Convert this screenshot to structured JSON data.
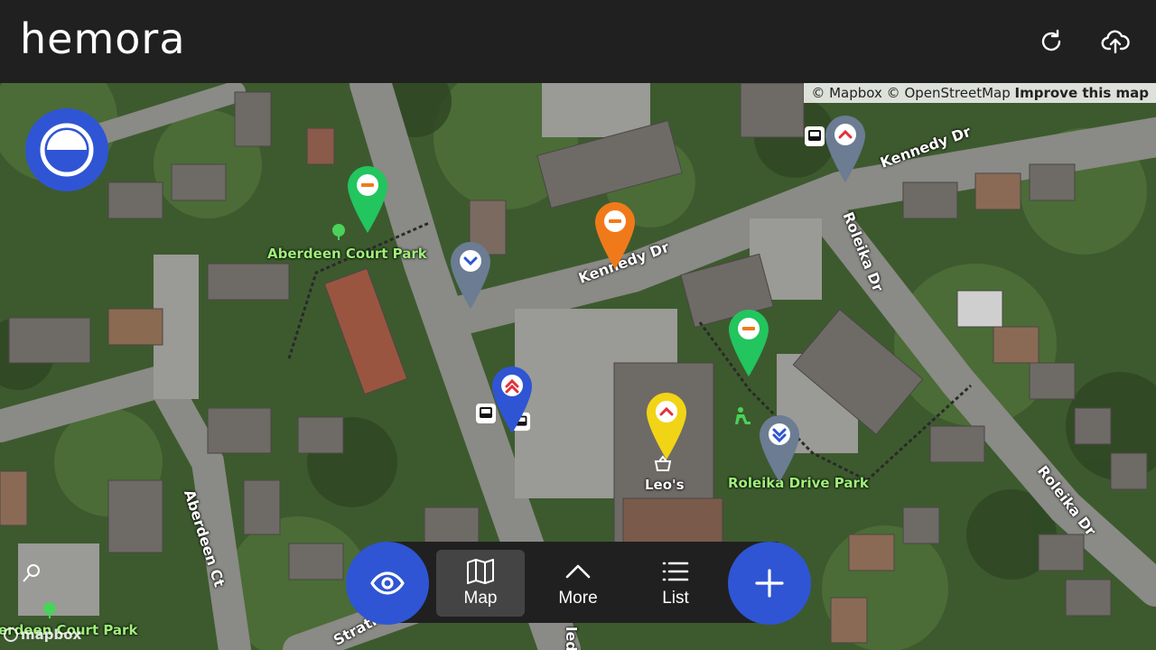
{
  "header": {
    "brand": "hemora",
    "refresh_icon": "refresh-icon",
    "upload_icon": "cloud-upload-icon"
  },
  "map": {
    "attribution": {
      "mapbox": "© Mapbox",
      "osm": "© OpenStreetMap",
      "improve": "Improve this map"
    },
    "logo": "mapbox",
    "labels": {
      "aberdeen_park_top": "Aberdeen Court Park",
      "aberdeen_park_bottom": "erdeen Court Park",
      "kennedy_dr_1": "Kennedy Dr",
      "kennedy_dr_2": "Kennedy Dr",
      "roleika_dr_1": "Roleika Dr",
      "roleika_dr_2": "Roleika Dr",
      "aberdeen_ct": "Aberdeen Ct",
      "roleika_park": "Roleika Drive Park",
      "leos": "Leo's",
      "strath": "Strath",
      "bottom_cut": "led"
    },
    "pins": [
      {
        "id": "green-top",
        "color": "#22c55e",
        "symbol": "minus"
      },
      {
        "id": "slate-left",
        "color": "#6b7c93",
        "symbol": "chevron-down"
      },
      {
        "id": "orange",
        "color": "#f07a1a",
        "symbol": "minus"
      },
      {
        "id": "slate-top-right",
        "color": "#6b7c93",
        "symbol": "chevron-up"
      },
      {
        "id": "green-right",
        "color": "#22c55e",
        "symbol": "minus"
      },
      {
        "id": "blue",
        "color": "#2f55d4",
        "symbol": "double-chevron-up"
      },
      {
        "id": "yellow",
        "color": "#f2d416",
        "symbol": "chevron-up"
      },
      {
        "id": "slate-bottom",
        "color": "#6b7c93",
        "symbol": "double-chevron-down"
      }
    ]
  },
  "controls": {
    "locate_icon": "location-half-icon"
  },
  "bottom_nav": {
    "eye_icon": "eye-icon",
    "map_label": "Map",
    "more_label": "More",
    "list_label": "List",
    "add_icon": "plus-icon"
  }
}
